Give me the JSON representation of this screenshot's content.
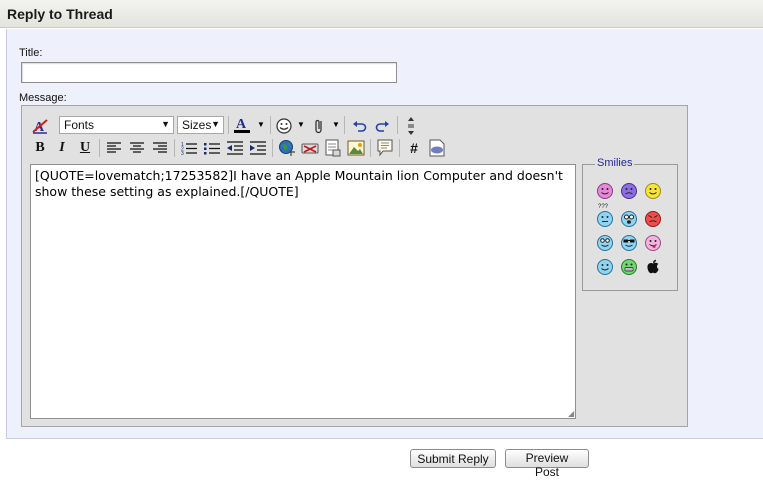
{
  "header": {
    "title": "Reply to Thread"
  },
  "form": {
    "title_label": "Title:",
    "title_value": "",
    "message_label": "Message:"
  },
  "toolbar": {
    "font_select": "Fonts",
    "size_select": "Sizes",
    "row1_icons": [
      "remove-format-icon",
      "font-color-icon",
      "smiley-icon",
      "attachment-icon",
      "undo-icon",
      "redo-icon",
      "resize-toggle-icon"
    ],
    "row2_icons": [
      "bold-icon",
      "italic-icon",
      "underline-icon",
      "align-left-icon",
      "align-center-icon",
      "align-right-icon",
      "ordered-list-icon",
      "unordered-list-icon",
      "outdent-icon",
      "indent-icon",
      "link-icon",
      "unlink-icon",
      "email-icon",
      "image-icon",
      "quote-icon",
      "code-icon",
      "php-icon"
    ],
    "bold": "B",
    "italic": "I",
    "underline": "U",
    "code": "#",
    "font_color_letter": "A"
  },
  "message": {
    "text": "[QUOTE=lovematch;17253582]I have an Apple Mountain lion Computer and doesn't show these setting as explained.[/QUOTE]"
  },
  "smilies": {
    "legend": "Smilies",
    "items": [
      "smile-pink",
      "mad-purple",
      "smile-yellow",
      "confused",
      "eek",
      "mad-red",
      "rolleyes",
      "cool",
      "tongue",
      "smile-blue",
      "grin-green",
      "apple"
    ],
    "confused_caption": "???"
  },
  "buttons": {
    "submit": "Submit Reply",
    "preview": "Preview Post"
  },
  "colors": {
    "panel_bg": "#eef0fb",
    "editor_bg": "#e1e1e1",
    "font_color_bar": "#000000",
    "legend_text": "#22279a"
  }
}
